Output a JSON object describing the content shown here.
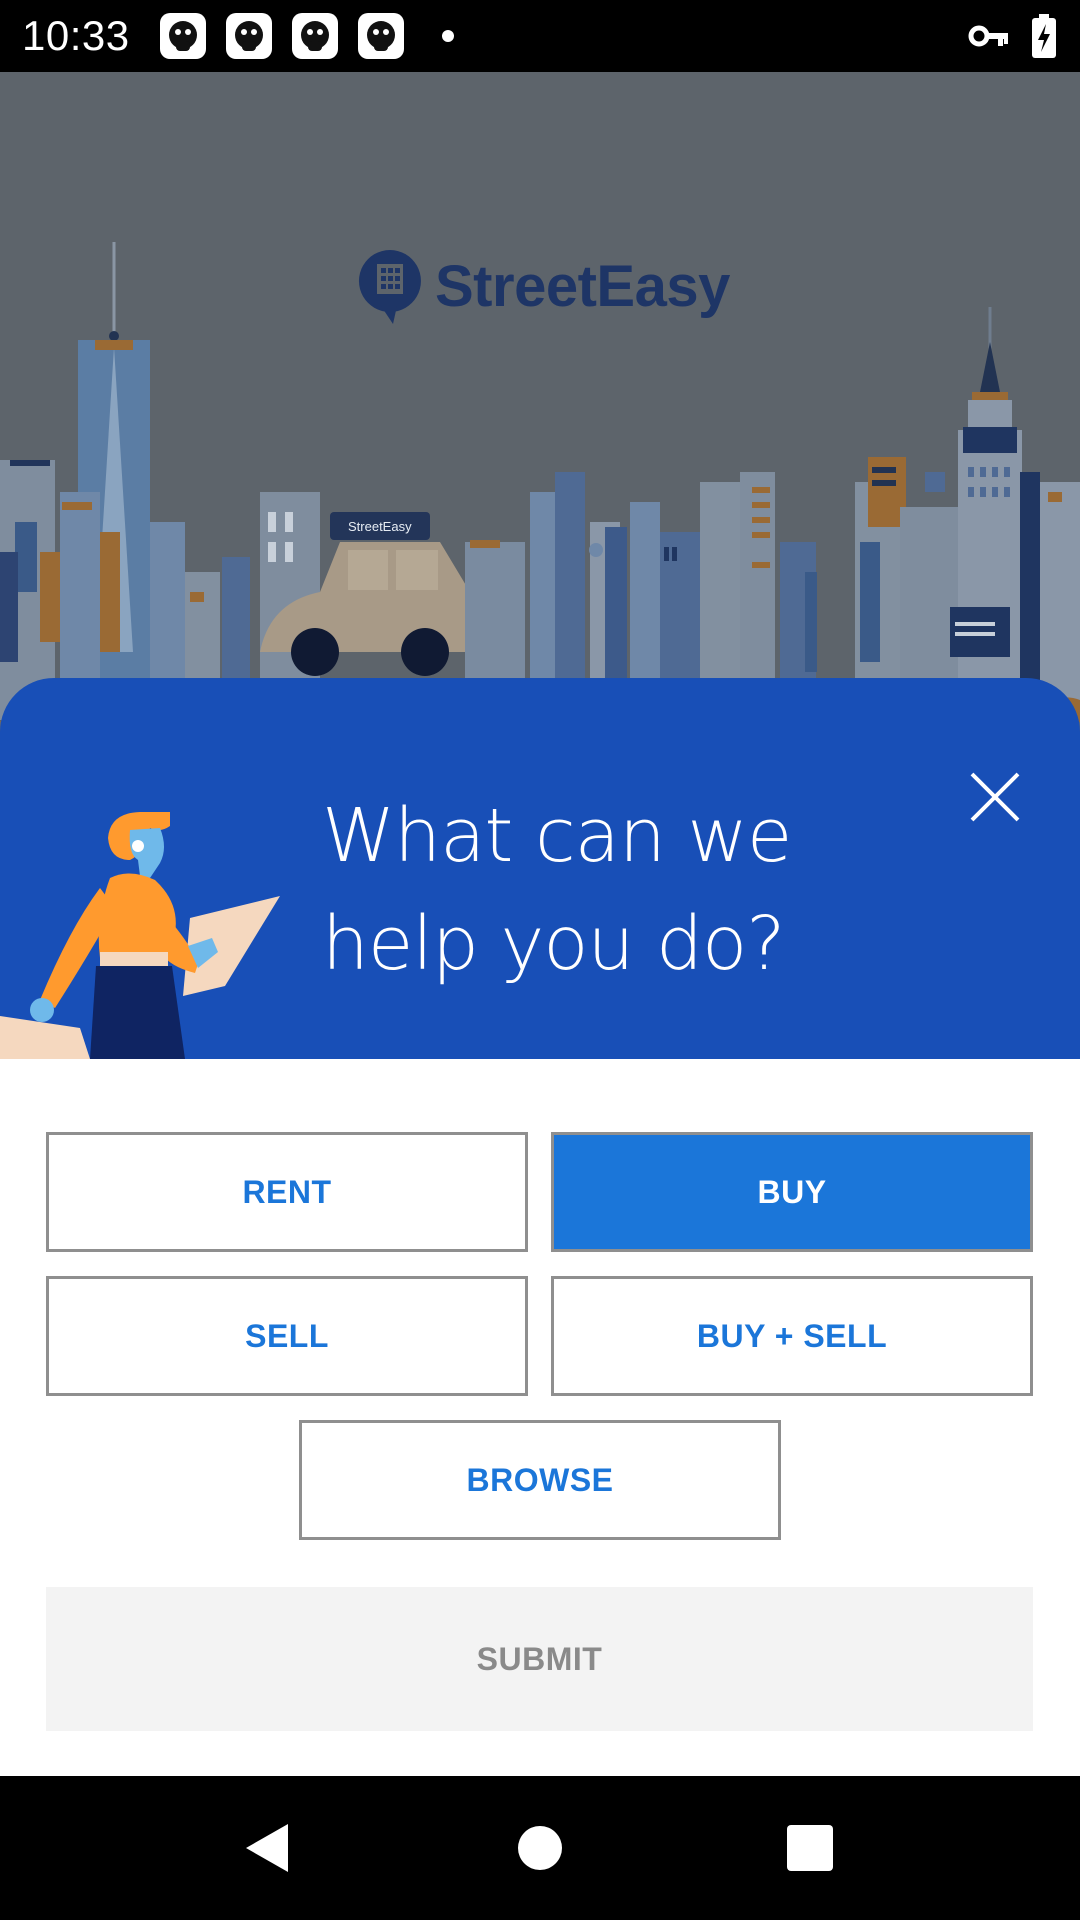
{
  "status_bar": {
    "time": "10:33",
    "notification_icons": [
      "app-mascot-icon",
      "app-mascot-icon",
      "app-mascot-icon",
      "app-mascot-icon"
    ],
    "indicators": [
      "vpn-key-icon",
      "battery-charging-icon"
    ]
  },
  "app": {
    "logo_text": "StreetEasy",
    "taxi_sign": "StreetEasy"
  },
  "dialog": {
    "title_line1": "What can we",
    "title_line2": "help you do?",
    "options": [
      {
        "label": "RENT",
        "selected": false
      },
      {
        "label": "BUY",
        "selected": true
      },
      {
        "label": "SELL",
        "selected": false
      },
      {
        "label": "BUY + SELL",
        "selected": false
      },
      {
        "label": "BROWSE",
        "selected": false
      }
    ],
    "submit_label": "SUBMIT"
  },
  "colors": {
    "sheet_header": "#184fb7",
    "option_text": "#1b76d9",
    "selected_fill": "#1b76d9",
    "scene_dim": "#5d646b"
  },
  "nav_bar": [
    "back-icon",
    "home-icon",
    "recents-icon"
  ]
}
